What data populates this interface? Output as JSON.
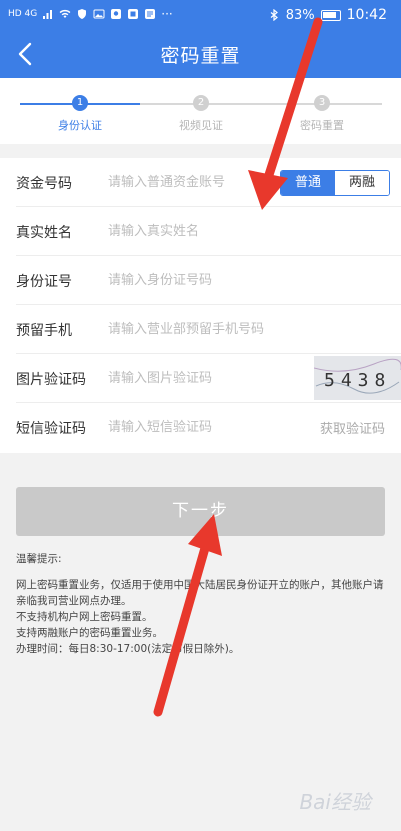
{
  "status_bar": {
    "network": "HD 4G",
    "battery_pct": "83%",
    "time": "10:42"
  },
  "header": {
    "title": "密码重置"
  },
  "steps": [
    {
      "num": "1",
      "label": "身份认证",
      "active": true
    },
    {
      "num": "2",
      "label": "视频见证",
      "active": false
    },
    {
      "num": "3",
      "label": "密码重置",
      "active": false
    }
  ],
  "form": {
    "account": {
      "label": "资金号码",
      "placeholder": "请输入普通资金账号"
    },
    "account_type": {
      "options": [
        "普通",
        "两融"
      ],
      "selected": "普通"
    },
    "name": {
      "label": "真实姓名",
      "placeholder": "请输入真实姓名"
    },
    "id_number": {
      "label": "身份证号",
      "placeholder": "请输入身份证号码"
    },
    "phone": {
      "label": "预留手机",
      "placeholder": "请输入营业部预留手机号码"
    },
    "captcha": {
      "label": "图片验证码",
      "placeholder": "请输入图片验证码",
      "image_text": "5438"
    },
    "sms": {
      "label": "短信验证码",
      "placeholder": "请输入短信验证码",
      "button": "获取验证码"
    }
  },
  "next_button": "下一步",
  "tips": {
    "title": "温馨提示:",
    "lines": [
      "网上密码重置业务，仅适用于使用中国大陆居民身份证开立的账户，其他账户请亲临我司营业网点办理。",
      "不支持机构户网上密码重置。",
      "支持两融账户的密码重置业务。",
      "办理时间：每日8:30-17:00(法定节假日除外)。"
    ]
  },
  "watermark": "Bai经验",
  "colors": {
    "primary": "#3c7ee6",
    "annotation_arrow": "#e8382c",
    "disabled_button": "#c9c9c9"
  }
}
